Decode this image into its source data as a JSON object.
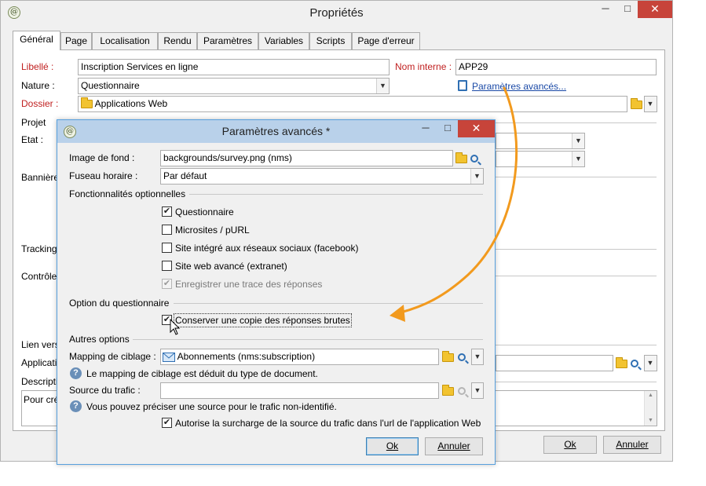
{
  "main": {
    "title": "Propriétés",
    "window_controls": {
      "minimize": "─",
      "maximize": "□",
      "close": "✕"
    },
    "tabs": [
      "Général",
      "Page",
      "Localisation",
      "Rendu",
      "Paramètres",
      "Variables",
      "Scripts",
      "Page d'erreur"
    ],
    "active_tab": "Général",
    "labels": {
      "libelle": "Libellé :",
      "nature": "Nature :",
      "dossier": "Dossier :",
      "projet": "Projet",
      "etat": "Etat :",
      "banniere": "Bannière",
      "tracking": "Tracking",
      "controle": "Contrôle",
      "lien": "Lien vers",
      "application": "Applicati",
      "description": "Descripti",
      "nom_interne": "Nom interne :"
    },
    "values": {
      "libelle": "Inscription Services en ligne",
      "nature": "Questionnaire",
      "dossier": "Applications Web",
      "nom_interne": "APP29",
      "description_text": "Pour cré"
    },
    "advanced_link": "Paramètres avancés...",
    "buttons": {
      "ok": "Ok",
      "cancel": "Annuler"
    }
  },
  "dialog": {
    "title": "Paramètres avancés *",
    "window_controls": {
      "minimize": "─",
      "maximize": "□",
      "close": "✕"
    },
    "labels": {
      "image_fond": "Image de fond :",
      "fuseau": "Fuseau horaire :",
      "mapping": "Mapping de ciblage :",
      "source": "Source du trafic :"
    },
    "values": {
      "image_fond": "backgrounds/survey.png (nms)",
      "fuseau": "Par défaut",
      "mapping": "Abonnements (nms:subscription)",
      "source": ""
    },
    "sections": {
      "fonctionnalites": "Fonctionnalités optionnelles",
      "option_questionnaire": "Option du questionnaire",
      "autres": "Autres options"
    },
    "features": [
      {
        "label": "Questionnaire",
        "checked": true,
        "disabled": false
      },
      {
        "label": "Microsites / pURL",
        "checked": false,
        "disabled": false
      },
      {
        "label": "Site intégré aux réseaux sociaux (facebook)",
        "checked": false,
        "disabled": false
      },
      {
        "label": "Site web avancé (extranet)",
        "checked": false,
        "disabled": false
      },
      {
        "label": "Enregistrer une trace des réponses",
        "checked": true,
        "disabled": true
      }
    ],
    "questionnaire_option": {
      "label": "Conserver une copie des réponses brutes",
      "checked": true
    },
    "help_mapping": "Le mapping de ciblage est déduit du type de document.",
    "help_source": "Vous pouvez préciser une source pour le trafic non-identifié.",
    "override": {
      "label": "Autorise la surcharge de la source du trafic dans l'url de l'application Web",
      "checked": true
    },
    "buttons": {
      "ok": "Ok",
      "cancel": "Annuler"
    }
  },
  "colors": {
    "accent_arrow": "#f29a1e",
    "dialog_border": "#57a0de",
    "required_label": "#c02020",
    "link": "#1a49a6"
  },
  "icons": [
    "app-icon",
    "folder-icon",
    "search-icon",
    "help-icon",
    "clipboard-icon",
    "envelope-icon",
    "mouse-cursor-icon"
  ]
}
